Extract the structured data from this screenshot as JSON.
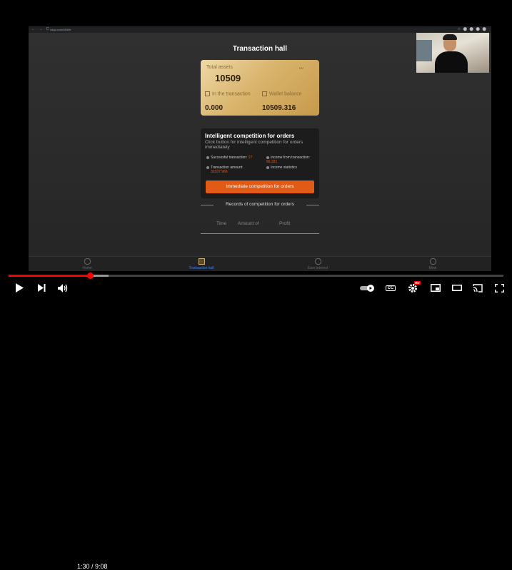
{
  "browser": {
    "url": "cdqs.com/h5/#/tr",
    "nav_glyphs": "← → C",
    "ext_glyphs": "☆ ⬤ ⬤ ⬤ ⬤"
  },
  "page": {
    "title": "Transaction hall",
    "card": {
      "total_assets_label": "Total assets",
      "total_assets_value": "10509",
      "in_transaction_label": "In the transaction",
      "in_transaction_value": "0.000",
      "wallet_balance_label": "Wallet balance",
      "wallet_balance_value": "10509.316"
    },
    "competition": {
      "heading": "Intelligent competition for orders",
      "description": "Click button for intelligent competition for orders immediately",
      "successful_label": "Successful transaction:",
      "successful_value": "27",
      "income_label": "Income from transaction:",
      "income_value": "56.321",
      "amount_label": "Transaction amount:",
      "amount_value": "32107.966",
      "stats_label": "Income statistics",
      "button_label": "Immediate competition for orders"
    },
    "records": {
      "heading": "Records of competition for orders",
      "columns": [
        "Time",
        "Amount of",
        "Profit"
      ]
    },
    "bottom_nav": [
      {
        "label": "Home",
        "active": false
      },
      {
        "label": "Transaction hall",
        "active": true
      },
      {
        "label": "Earn interest",
        "active": false
      },
      {
        "label": "Mine",
        "active": false
      }
    ]
  },
  "player": {
    "time_display": "1:30 / 9:08",
    "progress_fraction": 0.165,
    "progress_color": "#ff0000",
    "hd_badge": "HD",
    "icons": [
      "play-icon",
      "next-icon",
      "volume-icon",
      "autoplay-toggle",
      "captions-icon",
      "settings-icon",
      "miniplayer-icon",
      "theater-icon",
      "cast-icon",
      "fullscreen-icon"
    ],
    "cc_label": "CC"
  }
}
